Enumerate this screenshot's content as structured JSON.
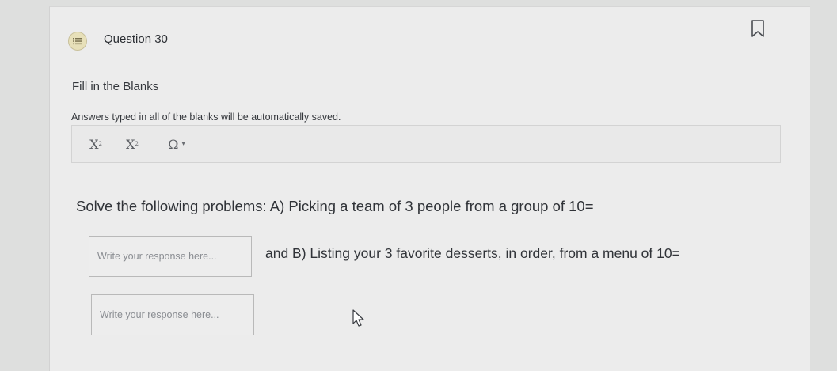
{
  "question": {
    "title": "Question 30",
    "icon": "list-icon",
    "type_label": "Fill in the Blanks",
    "note": "Answers typed in all of the blanks will be automatically saved."
  },
  "toolbar": {
    "subscript_icon": "subscript-icon",
    "superscript_icon": "superscript-icon",
    "special_chars_icon": "omega-icon"
  },
  "problem": {
    "part_a": "Solve the following problems: A) Picking a team of 3 people from a group of 10=",
    "part_b": "and B) Listing your 3 favorite desserts, in order, from a menu of 10="
  },
  "blanks": {
    "blank_1_placeholder": "Write your response here...",
    "blank_1_value": "",
    "blank_2_placeholder": "Write your response here...",
    "blank_2_value": ""
  }
}
